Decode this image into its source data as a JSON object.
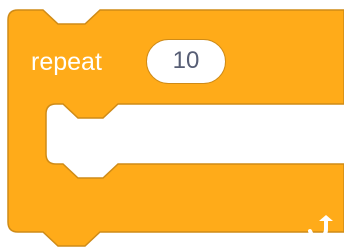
{
  "block": {
    "label": "repeat",
    "count": "10",
    "loop_icon": "rotate-arrow-icon",
    "colors": {
      "fill": "#ffab19",
      "border": "#cf8b17",
      "input_text": "#575e75",
      "slot": "#ffffff"
    }
  }
}
